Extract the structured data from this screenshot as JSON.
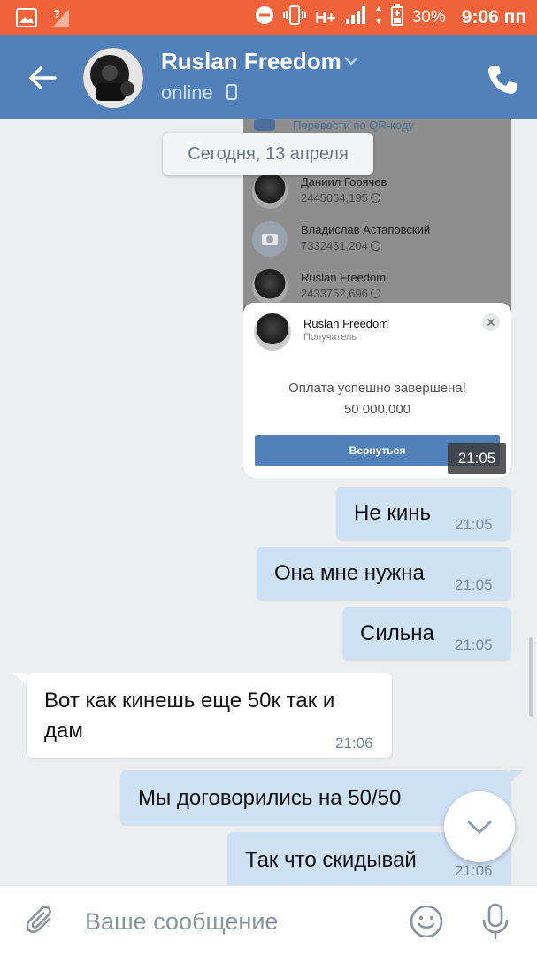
{
  "status_bar": {
    "battery": "30%",
    "time": "9:06 пп",
    "network": "H+"
  },
  "header": {
    "name": "Ruslan Freedom",
    "status": "online"
  },
  "chat": {
    "date": "Сегодня, 13 апреля",
    "screenshot": {
      "qr_text": "Перевести по QR-коду",
      "contacts": [
        {
          "name": "Даниил Горячев",
          "number": "2445064,195"
        },
        {
          "name": "Владислав Астаповский",
          "number": "7332461,204"
        },
        {
          "name": "Ruslan Freedom",
          "number": "2433752,696"
        }
      ],
      "card": {
        "recipient_name": "Ruslan Freedom",
        "recipient_role": "Получатель",
        "success": "Оплата успешно завершена!",
        "amount": "50 000,000",
        "button": "Вернуться"
      },
      "time": "21:05"
    },
    "messages": [
      {
        "text": "Не кинь",
        "time": "21:05",
        "direction": "out"
      },
      {
        "text": "Она мне нужна",
        "time": "21:05",
        "direction": "out"
      },
      {
        "text": "Сильна",
        "time": "21:05",
        "direction": "out"
      },
      {
        "line1": "Вот как кинешь еще 50к так и",
        "line2": "дам",
        "time": "21:06",
        "direction": "in"
      },
      {
        "text": "Мы договорились на 50/50",
        "time": "",
        "direction": "out"
      },
      {
        "text": "Так что скидывай",
        "time": "21:06",
        "direction": "out"
      }
    ]
  },
  "composer": {
    "placeholder": "Ваше сообщение"
  },
  "colors": {
    "status_bar": "#f0633a",
    "header": "#5181b8",
    "outgoing_bubble": "#cfe1f5",
    "incoming_bubble": "#ffffff",
    "background": "#edeef0"
  }
}
